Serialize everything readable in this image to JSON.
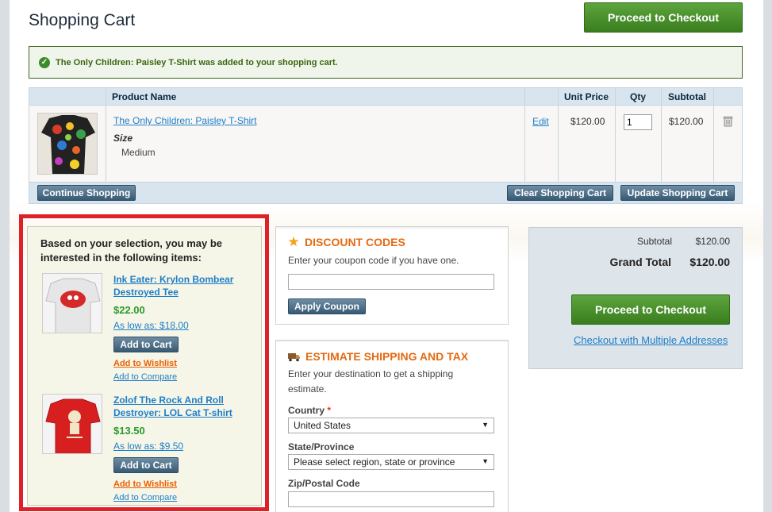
{
  "header": {
    "title": "Shopping Cart",
    "checkout_label": "Proceed to Checkout"
  },
  "success_message": "The Only Children: Paisley T-Shirt was added to your shopping cart.",
  "cart": {
    "columns": [
      "Product Name",
      "Unit Price",
      "Qty",
      "Subtotal"
    ],
    "items": [
      {
        "name": "The Only Children: Paisley T-Shirt",
        "option_label": "Size",
        "option_value": "Medium",
        "edit_label": "Edit",
        "unit_price": "$120.00",
        "qty": "1",
        "subtotal": "$120.00"
      }
    ],
    "continue_label": "Continue Shopping",
    "clear_label": "Clear Shopping Cart",
    "update_label": "Update Shopping Cart"
  },
  "crosssell": {
    "title": "Based on your selection, you may be interested in the following items:",
    "items": [
      {
        "name": "Ink Eater: Krylon Bombear Destroyed Tee",
        "price": "$22.00",
        "low_price": "As low as: $18.00",
        "add_to_cart": "Add to Cart",
        "wishlist": "Add to Wishlist",
        "compare": "Add to Compare"
      },
      {
        "name": "Zolof The Rock And Roll Destroyer: LOL Cat T-shirt",
        "price": "$13.50",
        "low_price": "As low as: $9.50",
        "add_to_cart": "Add to Cart",
        "wishlist": "Add to Wishlist",
        "compare": "Add to Compare"
      }
    ]
  },
  "discount": {
    "title": "DISCOUNT CODES",
    "description": "Enter your coupon code if you have one.",
    "coupon_value": "",
    "apply_label": "Apply Coupon"
  },
  "shipping": {
    "title": "ESTIMATE SHIPPING AND TAX",
    "description": "Enter your destination to get a shipping estimate.",
    "country_label": "Country",
    "required_mark": "*",
    "country_value": "United States",
    "state_label": "State/Province",
    "state_value": "Please select region, state or province",
    "zip_label": "Zip/Postal Code",
    "zip_value": ""
  },
  "totals": {
    "subtotal_label": "Subtotal",
    "subtotal_value": "$120.00",
    "grand_total_label": "Grand Total",
    "grand_total_value": "$120.00",
    "checkout_label": "Proceed to Checkout",
    "multi_address_label": "Checkout with Multiple Addresses"
  },
  "colors": {
    "checkout_green": "#4c9430",
    "link_blue": "#1e7ec8",
    "highlight_red": "#e02027",
    "section_orange": "#e36a12",
    "price_green": "#2a9a2a"
  }
}
